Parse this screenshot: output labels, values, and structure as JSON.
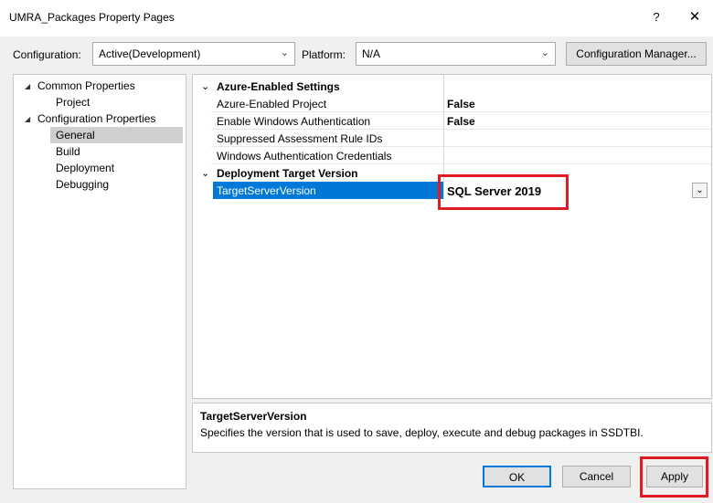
{
  "window": {
    "title": "UMRA_Packages Property Pages",
    "help_button": "?",
    "close_button": "✕"
  },
  "toolbar": {
    "configuration_label": "Configuration:",
    "configuration_value": "Active(Development)",
    "platform_label": "Platform:",
    "platform_value": "N/A",
    "config_manager_label": "Configuration Manager..."
  },
  "tree": {
    "items": [
      {
        "label": "Common Properties"
      },
      {
        "label": "Project"
      },
      {
        "label": "Configuration Properties"
      },
      {
        "label": "General"
      },
      {
        "label": "Build"
      },
      {
        "label": "Deployment"
      },
      {
        "label": "Debugging"
      }
    ]
  },
  "grid": {
    "categories": [
      {
        "title": "Azure-Enabled Settings",
        "rows": [
          {
            "name": "Azure-Enabled Project",
            "value": "False"
          },
          {
            "name": "Enable Windows Authentication",
            "value": "False"
          },
          {
            "name": "Suppressed Assessment Rule IDs",
            "value": ""
          },
          {
            "name": "Windows Authentication Credentials",
            "value": ""
          }
        ]
      },
      {
        "title": "Deployment Target Version",
        "rows": [
          {
            "name": "TargetServerVersion",
            "value": "SQL Server 2019"
          }
        ]
      }
    ]
  },
  "description": {
    "title": "TargetServerVersion",
    "text": "Specifies the version that is used to save, deploy, execute and debug packages in SSDTBI."
  },
  "footer": {
    "ok_label": "OK",
    "cancel_label": "Cancel",
    "apply_label": "Apply"
  },
  "colors": {
    "selection": "#0078d7",
    "highlight_box": "#e01b24"
  }
}
